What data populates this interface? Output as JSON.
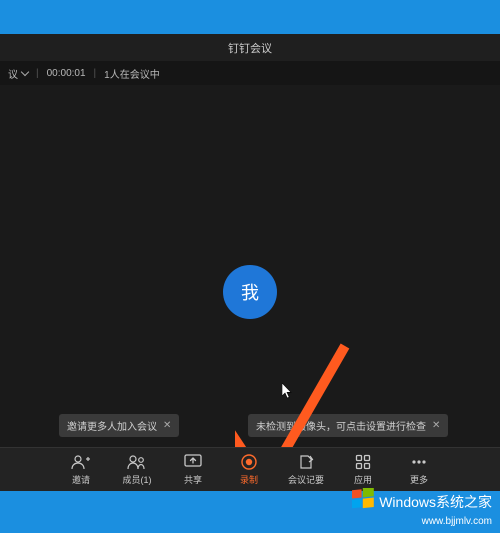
{
  "app": {
    "title": "钉钉会议"
  },
  "status": {
    "meeting_label": "议",
    "timer": "00:00:01",
    "participants": "1人在会议中"
  },
  "video": {
    "avatar_text": "我"
  },
  "tooltips": {
    "invite": "邀请更多人加入会议",
    "camera_check": "未检测到摄像头，可点击设置进行检查",
    "close": "✕"
  },
  "toolbar": {
    "invite": "邀请",
    "members": "成员(1)",
    "share": "共享",
    "record": "录制",
    "minutes": "会议记要",
    "apps": "应用",
    "more": "更多"
  },
  "watermark": {
    "text": "Windows系统之家",
    "url": "www.bjjmlv.com"
  }
}
